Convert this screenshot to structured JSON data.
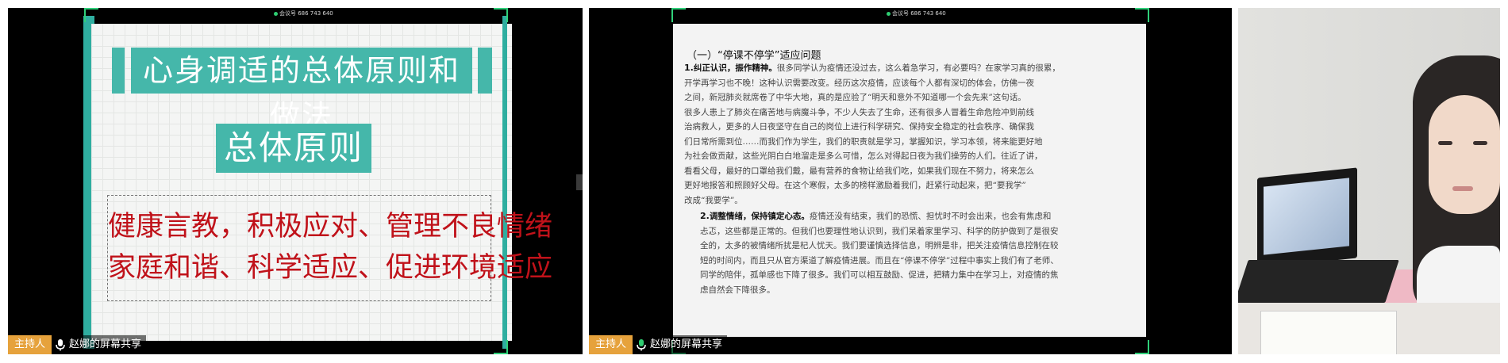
{
  "panels": [
    {
      "meeting_id": "会议号 686 743 640",
      "host_tag": "主持人",
      "share_label": "赵娜的屏幕共享",
      "slide": {
        "title": "心身调适的总体原则和做法",
        "subtitle": "总体原则",
        "principles": [
          "健康言教，积极应对、管理不良情绪",
          "家庭和谐、科学适应、促进环境适应"
        ]
      }
    },
    {
      "meeting_id": "会议号 686 743 640",
      "host_tag": "主持人",
      "share_label": "赵娜的屏幕共享",
      "document": {
        "heading": "（一）“停课不停学”适应问题",
        "para1_num": "1.",
        "para1_lead": "纠正认识，振作精神。",
        "para1_text": "很多同学认为疫情还没过去，这么着急学习，有必要吗？在家学习真的很累，\n开学再学习也不晚！这种认识需要改变。经历这次疫情，应该每个人都有深切的体会，仿佛一夜\n之间，新冠肺炎就席卷了中华大地，真的是应验了“明天和意外不知道哪一个会先来”这句话。\n很多人患上了肺炎在痛苦地与病魔斗争，不少人失去了生命，还有很多人冒着生命危险冲到前线\n治病救人，更多的人日夜坚守在自己的岗位上进行科学研究、保持安全稳定的社会秩序、确保我\n们日常所需到位……而我们作为学生，我们的职责就是学习，掌握知识，学习本领，将来能更好地\n为社会做贡献，这些光阴白白地溜走是多么可惜，怎么对得起日夜为我们操劳的人们。往近了讲，\n看看父母，最好的口罩给我们戴，最有营养的食物让给我们吃，如果我们现在不努力，将来怎么\n更好地报答和照顾好父母。在这个寒假，太多的榜样激励着我们，赶紧行动起来，把“要我学”\n改成“我要学”。",
        "para2_num": "2.",
        "para2_lead": "调整情绪，保持镇定心态。",
        "para2_text": "疫情还没有结束，我们的恐慌、担忧时不时会出来，也会有焦虑和\n忐忑，这些都是正常的。但我们也要理性地认识到，我们呆着家里学习、科学的防护做到了是很安\n全的，太多的被情绪所扰是杞人忧天。我们要谨慎选择信息，明辨是非，把关注疫情信息控制在较\n短的时间内，而且只从官方渠道了解疫情进展。而且在“停课不停学”过程中事实上我们有了老师、\n同学的陪伴，孤单感也下降了很多。我们可以相互鼓励、促进，把精力集中在学习上，对疫情的焦\n虑自然会下降很多。"
      }
    }
  ],
  "colors": {
    "teal_accent": "#45b7aa",
    "principle_red": "#c0121a",
    "host_tag": "#e6a23c",
    "share_border_green": "#2fd07a"
  }
}
